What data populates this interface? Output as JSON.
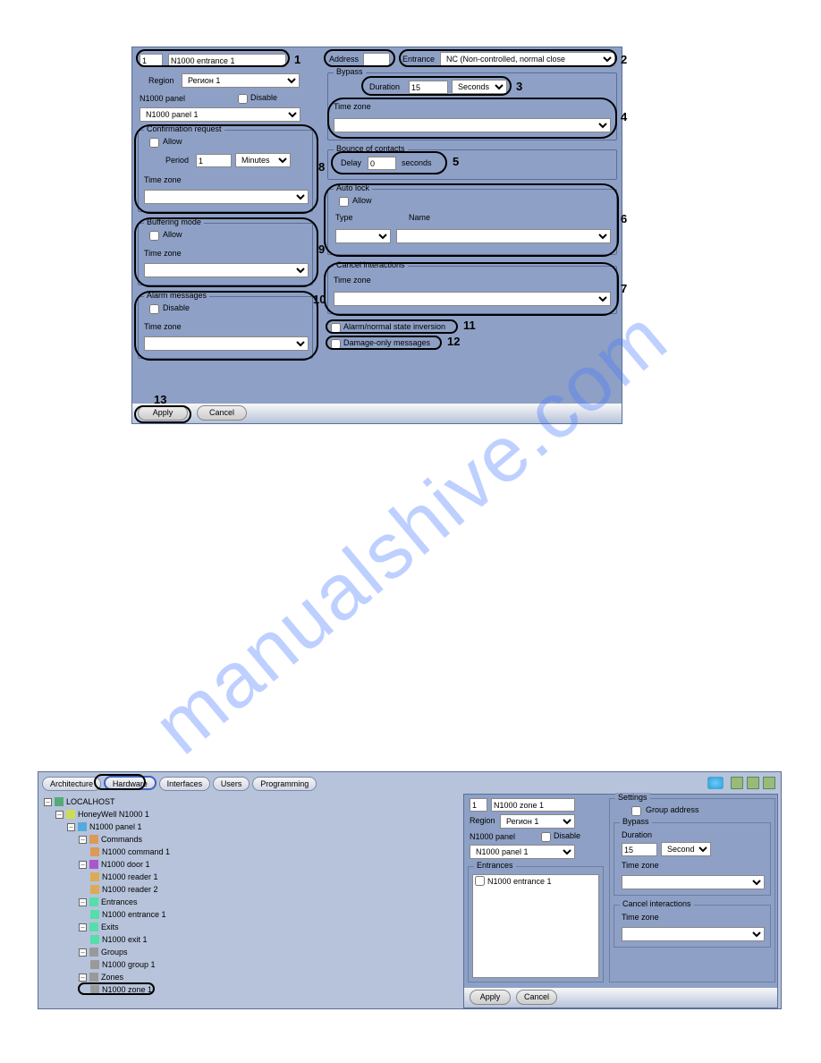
{
  "watermark": "manualshive.com",
  "fig1": {
    "id_value": "1",
    "name_value": "N1000 entrance 1",
    "region_label": "Region",
    "region_value": "Регион 1",
    "parent_label": "N1000 panel",
    "parent_value": "N1000 panel 1",
    "disable_label": "Disable",
    "confirmation": {
      "title": "Confirmation request",
      "allow_label": "Allow",
      "period_label": "Period",
      "period_value": "1",
      "period_unit": "Minutes",
      "tz_label": "Time zone"
    },
    "buffering": {
      "title": "Buffering mode",
      "allow_label": "Allow",
      "tz_label": "Time zone"
    },
    "alarm": {
      "title": "Alarm messages",
      "disable_label": "Disable",
      "tz_label": "Time zone"
    },
    "address_label": "Address",
    "address_value": "",
    "entrance_label": "Entrance",
    "entrance_value": "NC (Non-controlled, normal close",
    "bypass": {
      "title": "Bypass",
      "duration_label": "Duration",
      "duration_value": "15",
      "duration_unit": "Seconds",
      "tz_label": "Time zone"
    },
    "bounce": {
      "title": "Bounce of contacts",
      "delay_label": "Delay",
      "delay_value": "0",
      "seconds_label": "seconds"
    },
    "autolock": {
      "title": "Auto lock",
      "allow_label": "Allow",
      "type_label": "Type",
      "name_label": "Name"
    },
    "cancel": {
      "title": "Cancel interactions",
      "tz_label": "Time zone"
    },
    "inversion_label": "Alarm/normal state inversion",
    "damage_label": "Damage-only messages",
    "apply": "Apply",
    "cancel_btn": "Cancel",
    "callouts": {
      "1": "1",
      "2": "2",
      "3": "3",
      "4": "4",
      "5": "5",
      "6": "6",
      "7": "7",
      "8": "8",
      "9": "9",
      "10": "10",
      "11": "11",
      "12": "12",
      "13": "13"
    }
  },
  "fig2": {
    "tabs": {
      "arch": "Architecture",
      "hw": "Hardware",
      "if": "Interfaces",
      "users": "Users",
      "prog": "Programming"
    },
    "tree": {
      "root": "LOCALHOST",
      "hw": "HoneyWell N1000 1",
      "panel": "N1000 panel 1",
      "commands": "Commands",
      "cmd1": "N1000 command 1",
      "door": "N1000 door 1",
      "reader1": "N1000 reader 1",
      "reader2": "N1000 reader 2",
      "entrances": "Entrances",
      "entrance1": "N1000 entrance 1",
      "exits": "Exits",
      "exit1": "N1000 exit 1",
      "groups": "Groups",
      "group1": "N1000 group 1",
      "zones": "Zones",
      "zone1": "N1000 zone 1"
    },
    "props": {
      "id_value": "1",
      "name_value": "N1000 zone 1",
      "region_label": "Region",
      "region_value": "Регион 1",
      "parent_label": "N1000 panel",
      "parent_value": "N1000 panel 1",
      "disable_label": "Disable",
      "entrances_title": "Entrances",
      "entrance_item": "N1000 entrance 1",
      "settings_title": "Settings",
      "group_addr_label": "Group address",
      "bypass_title": "Bypass",
      "duration_label": "Duration",
      "duration_value": "15",
      "duration_unit": "Seconds",
      "tz_label": "Time zone",
      "cancel_title": "Cancel interactions",
      "cancel_tz_label": "Time zone",
      "apply": "Apply",
      "cancel_btn": "Cancel"
    }
  }
}
